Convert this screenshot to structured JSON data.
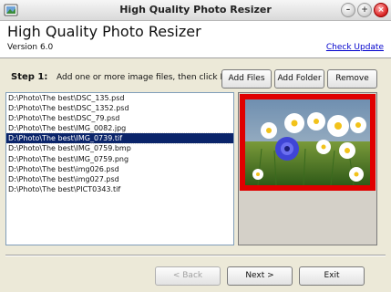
{
  "window": {
    "title": "High Quality Photo Resizer"
  },
  "header": {
    "app_title": "High Quality Photo Resizer",
    "version": "Version 6.0",
    "check_update": "Check Update"
  },
  "step": {
    "label": "Step 1:",
    "instruction": "Add one or more image files, then click Next."
  },
  "buttons": {
    "add_files": "Add Files",
    "add_folder": "Add Folder",
    "remove": "Remove",
    "back": "< Back",
    "next": "Next >",
    "exit": "Exit"
  },
  "files": [
    "D:\\Photo\\The best\\DSC_135.psd",
    "D:\\Photo\\The best\\DSC_1352.psd",
    "D:\\Photo\\The best\\DSC_79.psd",
    "D:\\Photo\\The best\\IMG_0082.jpg",
    "D:\\Photo\\The best\\IMG_0739.tif",
    "D:\\Photo\\The best\\IMG_0759.bmp",
    "D:\\Photo\\The best\\IMG_0759.png",
    "D:\\Photo\\The best\\img026.psd",
    "D:\\Photo\\The best\\img027.psd",
    "D:\\Photo\\The best\\PICT0343.tif"
  ],
  "selected_file_index": 4,
  "colors": {
    "selection": "#0a246a",
    "preview_border": "#e00000",
    "link": "#0000cc"
  }
}
